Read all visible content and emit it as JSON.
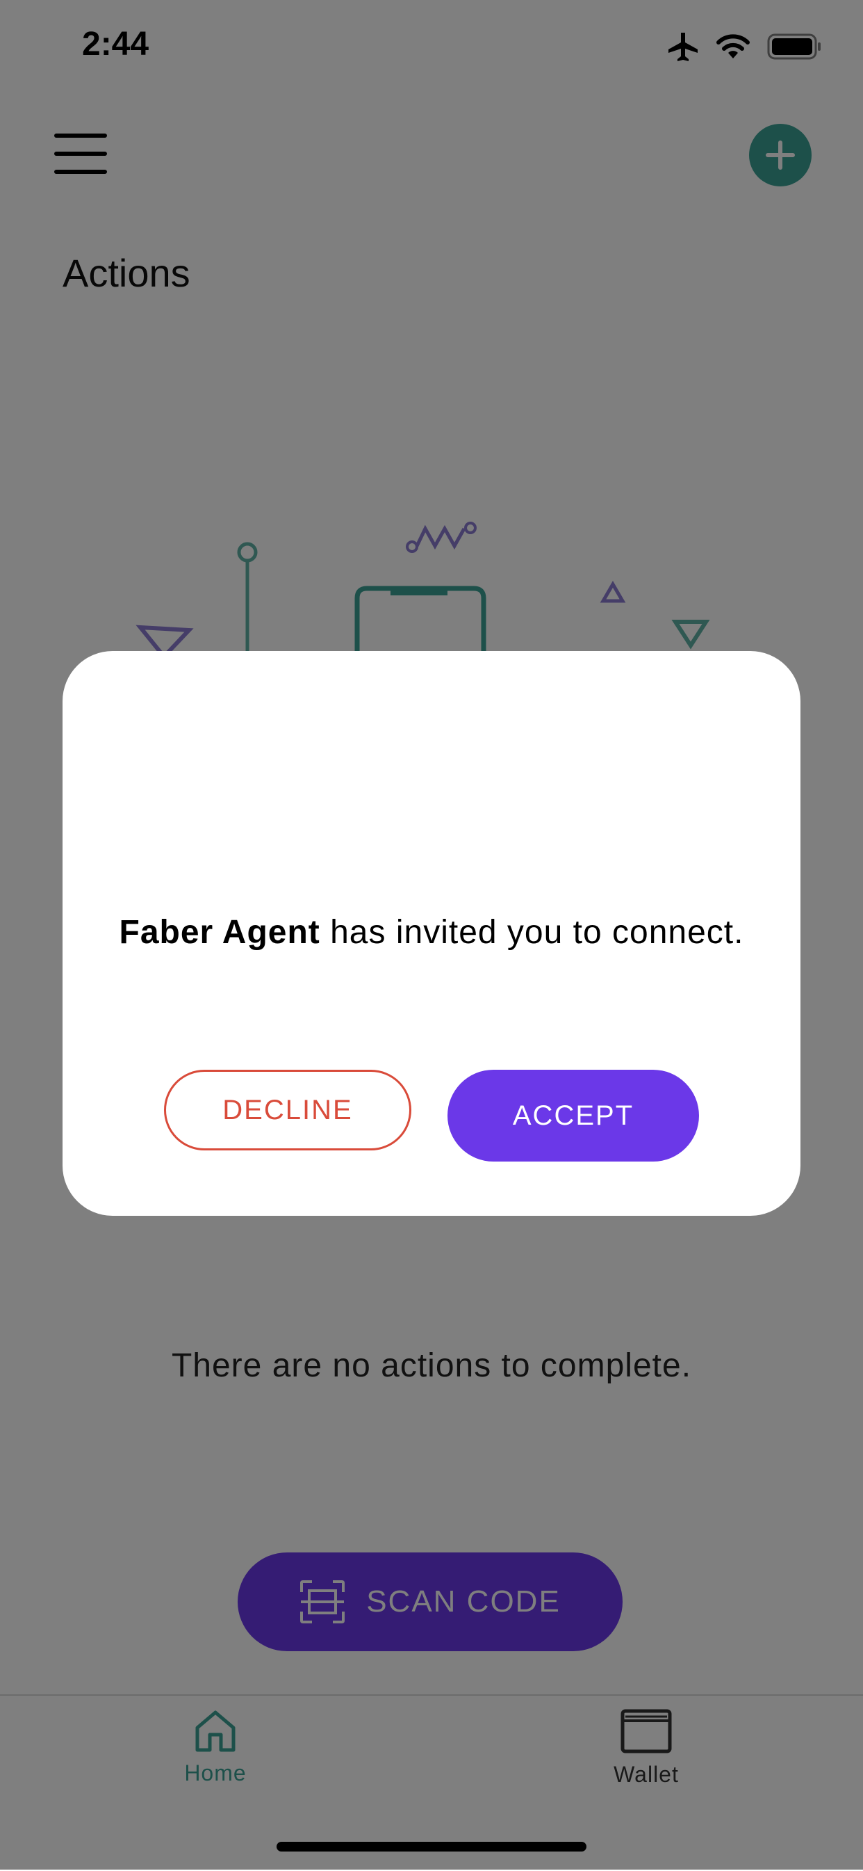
{
  "status_bar": {
    "time": "2:44"
  },
  "header": {
    "title": "Actions"
  },
  "empty_state": {
    "message": "There are no actions to complete."
  },
  "scan": {
    "label": "SCAN CODE"
  },
  "tabs": [
    {
      "label": "Home",
      "icon": "home-icon",
      "active": true
    },
    {
      "label": "Wallet",
      "icon": "wallet-icon",
      "active": false
    }
  ],
  "modal": {
    "agent_name": "Faber Agent",
    "message_rest": " has invited you to connect.",
    "decline_label": "DECLINE",
    "accept_label": "ACCEPT"
  },
  "colors": {
    "accent_purple": "#6b38e8",
    "accent_teal": "#3aa094",
    "decline_red": "#d94b3a"
  }
}
